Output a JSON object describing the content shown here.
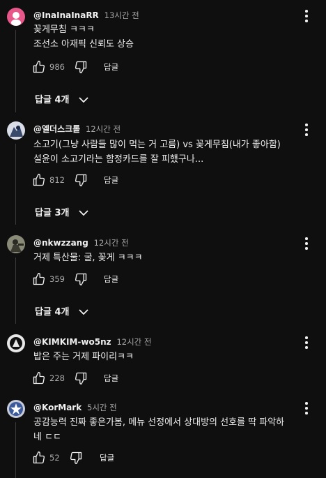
{
  "comments": [
    {
      "author": "@InaInaInaRR",
      "time": "13시간 전",
      "lines": [
        "꽂게무침 ㅋㅋㅋ",
        "조선소 아재픽 신뢰도 상승"
      ],
      "likes": "986",
      "reply_label": "답글",
      "replies_label": "답글 4개",
      "avatar_color": "#e8578a"
    },
    {
      "author": "@엘더스크롤",
      "time": "12시간 전",
      "lines": [
        "소고기(그냥 사람들 많이 먹는 거 고름) vs 꽂게무침(내가 좋아함)",
        "설윤이 소고기라는 함정카드를 잘 피했구나..."
      ],
      "likes": "812",
      "reply_label": "답글",
      "replies_label": "답글 3개",
      "avatar_color": "#5a6a8a"
    },
    {
      "author": "@nkwzzang",
      "time": "12시간 전",
      "lines": [
        "거제 특산물: 굴, 꽂게 ㅋㅋㅋ"
      ],
      "likes": "359",
      "reply_label": "답글",
      "replies_label": "답글 4개",
      "avatar_color": "#6b6b55"
    },
    {
      "author": "@KIMKIM-wo5nz",
      "time": "12시간 전",
      "lines": [
        "밥은 주는 거제 파이리ㅋㅋ"
      ],
      "likes": "228",
      "reply_label": "답글",
      "avatar_color": "#222222"
    },
    {
      "author": "@KorMark",
      "time": "5시간 전",
      "lines": [
        "공감능력 진짜 좋은가봄, 메뉴 선정에서 상대방의 선호를 딱 파악하",
        "네 ㄷㄷ"
      ],
      "likes": "52",
      "reply_label": "답글",
      "avatar_color": "#3c5a9a"
    }
  ]
}
